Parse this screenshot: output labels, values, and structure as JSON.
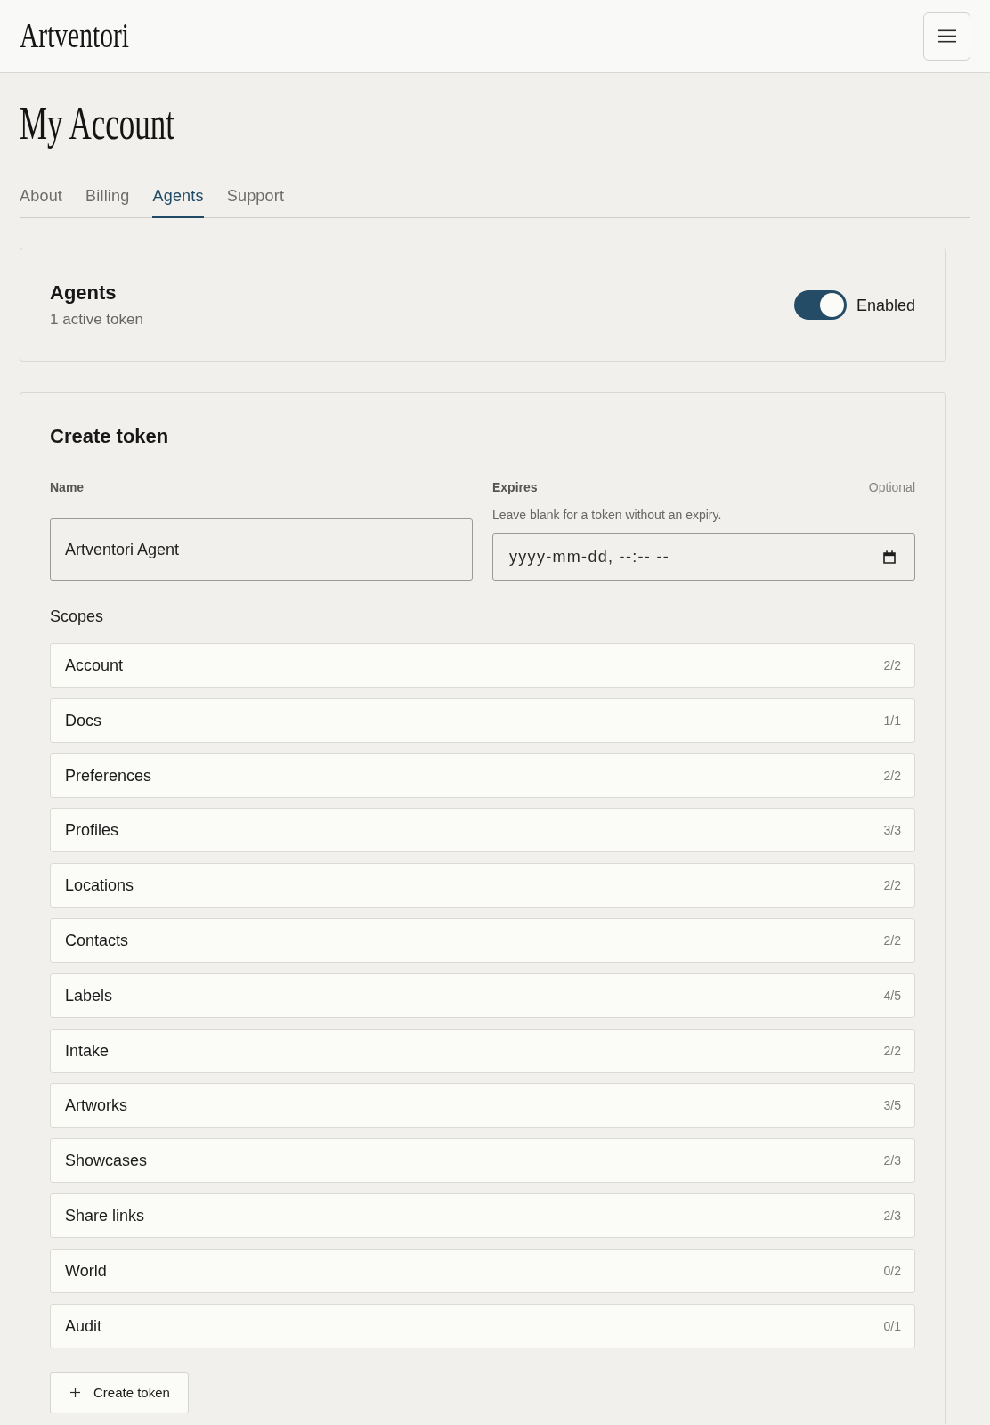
{
  "header": {
    "logo": "Artventori"
  },
  "page_title": "My Account",
  "tabs": [
    {
      "label": "About",
      "selected": false
    },
    {
      "label": "Billing",
      "selected": false
    },
    {
      "label": "Agents",
      "selected": true
    },
    {
      "label": "Support",
      "selected": false
    }
  ],
  "agents_card": {
    "title": "Agents",
    "subtitle": "1 active token",
    "toggle": {
      "on": true,
      "label": "Enabled"
    }
  },
  "create_token": {
    "title": "Create token",
    "name_field": {
      "label": "Name",
      "value": "Artventori Agent"
    },
    "expires_field": {
      "label": "Expires",
      "optional": "Optional",
      "hint": "Leave blank for a token without an expiry.",
      "placeholder": "yyyy-mm-dd, --:-- --"
    },
    "scopes_label": "Scopes",
    "scopes": [
      {
        "name": "Account",
        "count": "2/2"
      },
      {
        "name": "Docs",
        "count": "1/1"
      },
      {
        "name": "Preferences",
        "count": "2/2"
      },
      {
        "name": "Profiles",
        "count": "3/3"
      },
      {
        "name": "Locations",
        "count": "2/2"
      },
      {
        "name": "Contacts",
        "count": "2/2"
      },
      {
        "name": "Labels",
        "count": "4/5"
      },
      {
        "name": "Intake",
        "count": "2/2"
      },
      {
        "name": "Artworks",
        "count": "3/5"
      },
      {
        "name": "Showcases",
        "count": "2/3"
      },
      {
        "name": "Share links",
        "count": "2/3"
      },
      {
        "name": "World",
        "count": "0/2"
      },
      {
        "name": "Audit",
        "count": "0/1"
      }
    ],
    "submit_button": "Create token"
  }
}
